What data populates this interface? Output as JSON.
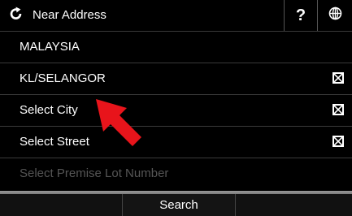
{
  "header": {
    "title": "Near Address",
    "back_icon": "refresh-back-icon",
    "help_label": "?",
    "globe_icon": "globe-icon"
  },
  "rows": [
    {
      "label": "MALAYSIA",
      "has_checkbox": false,
      "disabled": false
    },
    {
      "label": "KL/SELANGOR",
      "has_checkbox": true,
      "disabled": false
    },
    {
      "label": "Select City",
      "has_checkbox": true,
      "disabled": false
    },
    {
      "label": "Select Street",
      "has_checkbox": true,
      "disabled": false
    },
    {
      "label": "Select Premise Lot Number",
      "has_checkbox": false,
      "disabled": true
    }
  ],
  "footer": {
    "search_label": "Search"
  },
  "colors": {
    "background": "#000000",
    "pointer": "#e8141b",
    "disabled_text": "#555555"
  }
}
